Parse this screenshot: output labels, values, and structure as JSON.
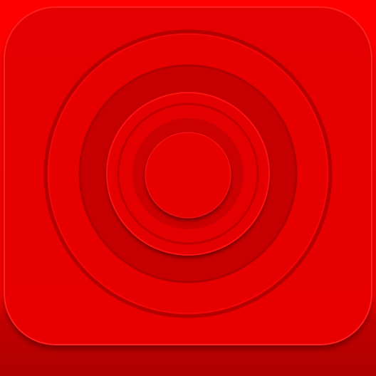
{
  "icon": {
    "name": "concentric-rings-icon",
    "colors": {
      "background": "#ff0000",
      "background_bottom": "#b80000",
      "tile": "#e60000",
      "tile_edge": "#ff1a1a",
      "ring_outer": "#e80000",
      "ring_groove": "#b80000",
      "ring_band_dark": "#c90000",
      "ring_inner": "#e80000",
      "center_disc": "#e80000"
    }
  }
}
